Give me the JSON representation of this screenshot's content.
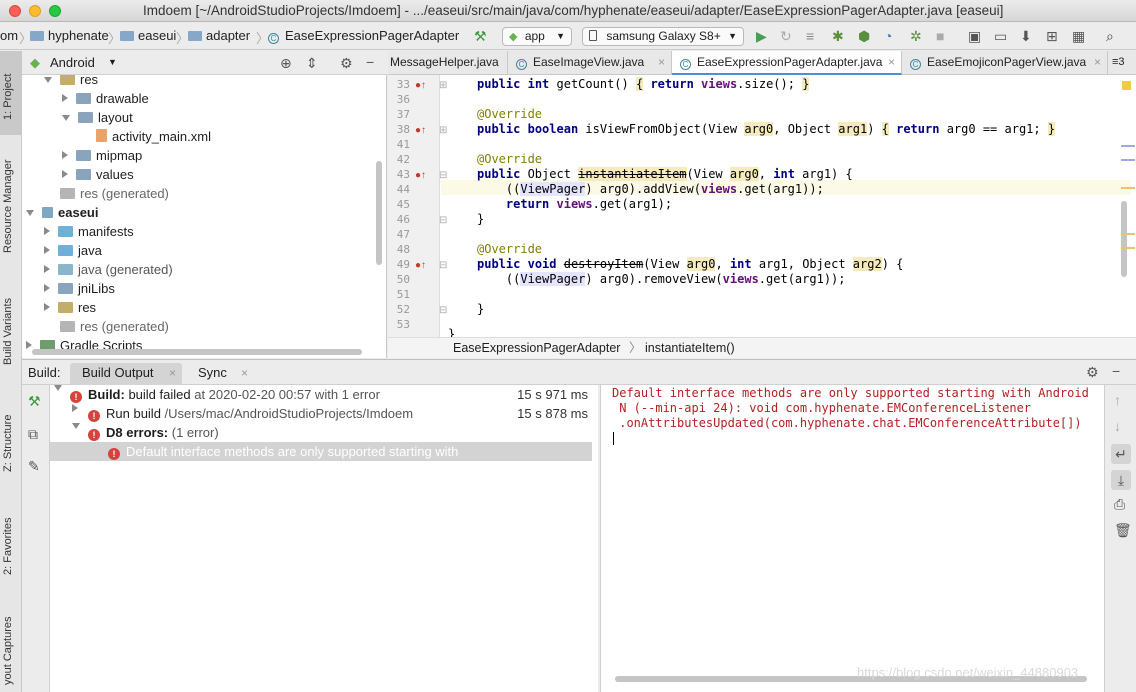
{
  "window": {
    "title": "Imdoem [~/AndroidStudioProjects/Imdoem] - .../easeui/src/main/java/com/hyphenate/easeui/adapter/EaseExpressionPagerAdapter.java [easeui]"
  },
  "toolbar": {
    "breadcrumb": [
      "om",
      "hyphenate",
      "easeui",
      "adapter",
      "EaseExpressionPagerAdapter"
    ],
    "run_config": "app",
    "device": "samsung Galaxy S8+"
  },
  "left_strip": {
    "tabs": [
      "1: Project",
      "Resource Manager",
      "Build Variants",
      "Z: Structure",
      "2: Favorites",
      "yout Captures"
    ]
  },
  "project": {
    "view": "Android",
    "tree": [
      {
        "label": "res",
        "type": "folder"
      },
      {
        "label": "drawable",
        "type": "folder"
      },
      {
        "label": "layout",
        "type": "folder"
      },
      {
        "label": "activity_main.xml",
        "type": "xml"
      },
      {
        "label": "mipmap",
        "type": "folder"
      },
      {
        "label": "values",
        "type": "folder"
      },
      {
        "label": "res (generated)",
        "type": "folder"
      },
      {
        "label": "easeui",
        "type": "module"
      },
      {
        "label": "manifests",
        "type": "folder"
      },
      {
        "label": "java",
        "type": "folder"
      },
      {
        "label": "java (generated)",
        "type": "folder"
      },
      {
        "label": "jniLibs",
        "type": "folder"
      },
      {
        "label": "res",
        "type": "folder"
      },
      {
        "label": "res (generated)",
        "type": "folder"
      },
      {
        "label": "Gradle Scripts",
        "type": "gradle"
      }
    ]
  },
  "editor": {
    "tabs": [
      "MessageHelper.java",
      "EaseImageView.java",
      "EaseExpressionPagerAdapter.java",
      "EaseEmojiconPagerView.java"
    ],
    "tab_overflow": "3",
    "active_tab": "EaseExpressionPagerAdapter.java",
    "line_numbers": [
      "33",
      "36",
      "37",
      "38",
      "41",
      "42",
      "43",
      "44",
      "45",
      "46",
      "47",
      "48",
      "49",
      "50",
      "51",
      "52",
      "53"
    ],
    "breadcrumb_class": "EaseExpressionPagerAdapter",
    "breadcrumb_method": "instantiateItem()"
  },
  "build": {
    "label": "Build:",
    "tabs": [
      "Build Output",
      "Sync"
    ],
    "tree": [
      {
        "bold": "Build:",
        "text": " build failed",
        "gray": " at 2020-02-20 00:57  with 1 error",
        "time": "15 s 971 ms"
      },
      {
        "bold": "",
        "text": "Run build",
        "gray": " /Users/mac/AndroidStudioProjects/Imdoem",
        "time": "15 s 878 ms"
      },
      {
        "bold": "D8 errors:",
        "text": "",
        "gray": " (1 error)",
        "time": ""
      },
      {
        "bold": "",
        "text": "Default interface methods are only supported starting with",
        "gray": "",
        "time": ""
      }
    ],
    "output": [
      "Default interface methods are only supported starting with Android",
      " N (--min-api 24): void com.hyphenate.EMConferenceListener",
      " .onAttributesUpdated(com.hyphenate.chat.EMConferenceAttribute[])"
    ]
  },
  "watermark": "https://blog.csdn.net/weixin_44880903"
}
